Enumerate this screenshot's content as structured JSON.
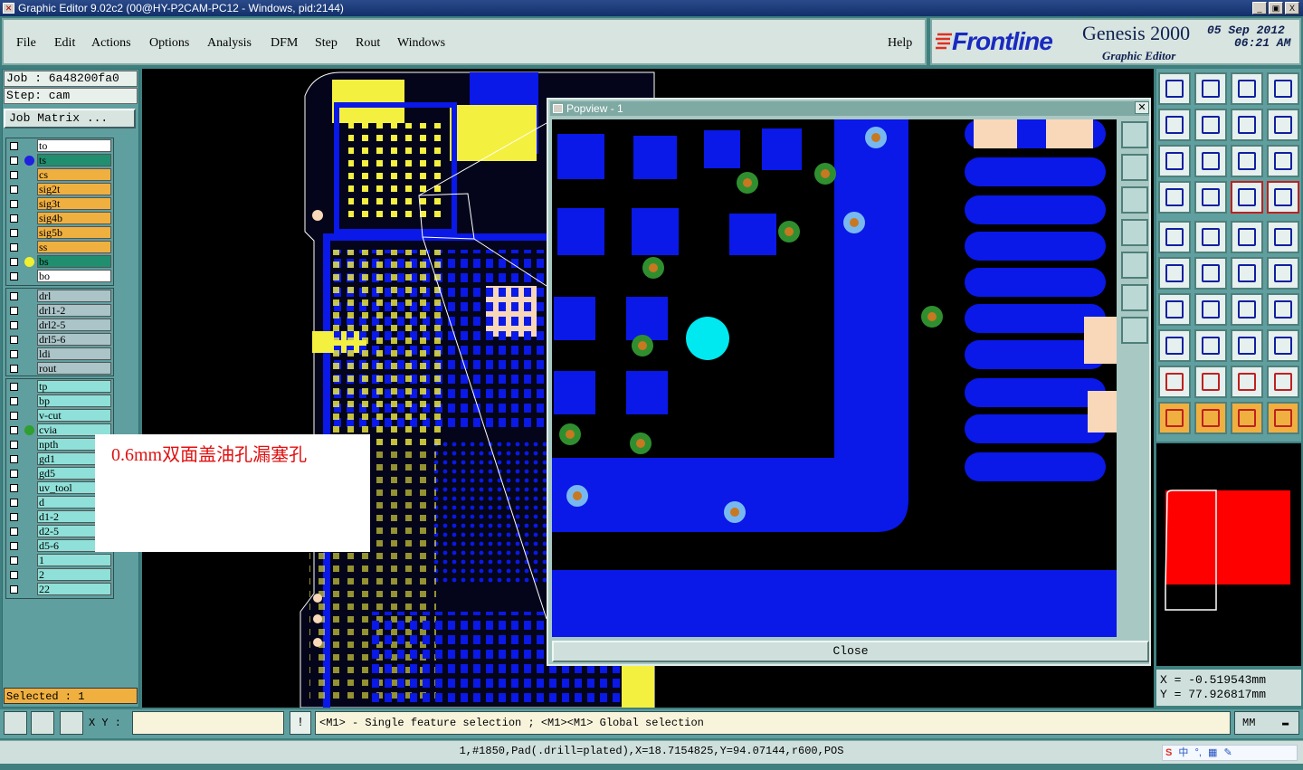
{
  "window": {
    "title": "Graphic Editor 9.02c2 (00@HY-P2CAM-PC12 - Windows, pid:2144)",
    "controls": [
      "_",
      "▣",
      "X"
    ]
  },
  "menu": [
    "File",
    "Edit",
    "Actions",
    "Options",
    "Analysis",
    "DFM",
    "Step",
    "Rout",
    "Windows"
  ],
  "help_label": "Help",
  "brand": {
    "logo": "Frontline",
    "product": "Genesis 2000",
    "subtitle": "Graphic Editor",
    "date": "05 Sep 2012",
    "time": "06:21 AM"
  },
  "job": {
    "job_label": "Job : 6a48200fa0",
    "step_label": "Step: cam",
    "matrix_button": "Job Matrix ..."
  },
  "layers_group1": [
    {
      "name": "to",
      "bg": "#ffffff",
      "dot": ""
    },
    {
      "name": "ts",
      "bg": "#1f8f6f",
      "dot": "#2020e0"
    },
    {
      "name": "cs",
      "bg": "#f0b040",
      "dot": ""
    },
    {
      "name": "sig2t",
      "bg": "#f0b040",
      "dot": ""
    },
    {
      "name": "sig3t",
      "bg": "#f0b040",
      "dot": ""
    },
    {
      "name": "sig4b",
      "bg": "#f0b040",
      "dot": ""
    },
    {
      "name": "sig5b",
      "bg": "#f0b040",
      "dot": ""
    },
    {
      "name": "ss",
      "bg": "#f0b040",
      "dot": ""
    },
    {
      "name": "bs",
      "bg": "#1f8f6f",
      "dot": "#f0f030"
    },
    {
      "name": "bo",
      "bg": "#ffffff",
      "dot": ""
    }
  ],
  "layers_group2": [
    "drl",
    "drl1-2",
    "drl2-5",
    "drl5-6",
    "ldi",
    "rout"
  ],
  "layers_group3": [
    {
      "name": "tp",
      "dot": ""
    },
    {
      "name": "bp",
      "dot": ""
    },
    {
      "name": "v-cut",
      "dot": ""
    },
    {
      "name": "cvia",
      "dot": "#2f9f2f"
    },
    {
      "name": "npth",
      "dot": ""
    },
    {
      "name": "gd1",
      "dot": ""
    },
    {
      "name": "gd5",
      "dot": ""
    },
    {
      "name": "uv_tool",
      "dot": ""
    },
    {
      "name": "d",
      "dot": ""
    },
    {
      "name": "d1-2",
      "dot": ""
    },
    {
      "name": "d2-5",
      "dot": ""
    },
    {
      "name": "d5-6",
      "dot": ""
    },
    {
      "name": "1",
      "dot": ""
    },
    {
      "name": "2",
      "dot": ""
    },
    {
      "name": "22",
      "dot": ""
    }
  ],
  "selected_label": "Selected : 1",
  "annotation_text": "0.6mm双面盖油孔漏塞孔",
  "popview": {
    "title": "Popview - 1",
    "close_label": "Close"
  },
  "coords": {
    "x": "X = -0.519543mm",
    "y": "Y = 77.926817mm"
  },
  "command": {
    "xy_label": "X Y :",
    "xy_value": "",
    "bang": "!",
    "hint": "<M1> - Single feature selection ; <M1><M1> Global selection",
    "units": "MM"
  },
  "status_text": "1,#1850,Pad(.drill=plated),X=18.7154825,Y=94.07144,r600,POS",
  "colors": {
    "pcb_blue": "#0a18e8",
    "pad_yellow": "#f4f040",
    "background": "#000000",
    "via_green": "#2f8f2f",
    "via_orange": "#c87820",
    "cyan": "#00e8f0",
    "peach": "#f8d8b8",
    "profile_red": "#ff0000"
  }
}
